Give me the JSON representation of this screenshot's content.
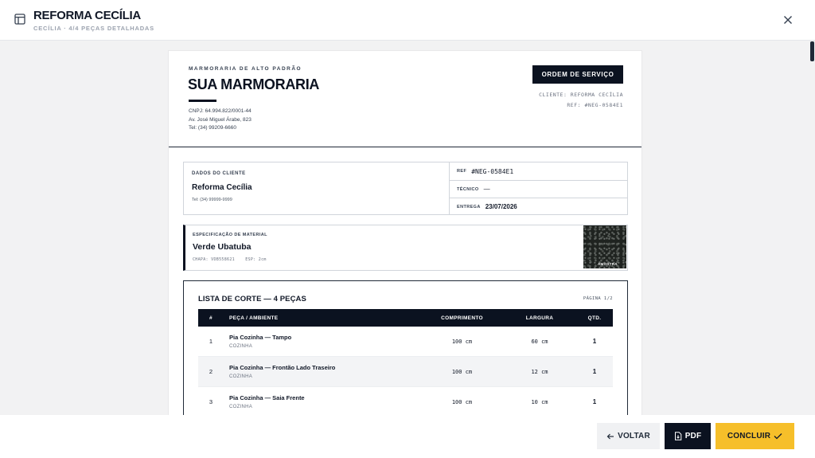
{
  "header": {
    "title": "REFORMA CECÍLIA",
    "subtitle": "CECÍLIA · 4/4 PEÇAS DETALHADAS"
  },
  "document": {
    "company_kicker": "MARMORARIA DE ALTO PADRÃO",
    "company_name": "SUA MARMORARIA",
    "cnpj": "CNPJ: 64.994.822/0001-44",
    "address": "Av. José Miguel Árabe, 823",
    "phone": "Tel: (34) 99209-6660",
    "order_badge": "ORDEM DE SERVIÇO",
    "meta_client": "CLIENTE: REFORMA CECÍLIA",
    "meta_ref": "REF: #NEG-0584E1",
    "client": {
      "section_label": "DADOS DO CLIENTE",
      "name": "Reforma Cecília",
      "phone": "Tel: (34) 99999-9999",
      "ref_label": "REF",
      "ref_value": "#NEG-0584E1",
      "tech_label": "TÉCNICO",
      "tech_value": "—",
      "delivery_label": "ENTREGA",
      "delivery_value": "23/07/2026"
    },
    "material": {
      "section_label": "ESPECIFICAÇÃO DE MATERIAL",
      "name": "Verde Ubatuba",
      "meta": "CHAPA: VDB558621    ESP: 2cm",
      "sample_label": "AMOSTRA"
    },
    "cut_list": {
      "title": "LISTA DE CORTE — 4 PEÇAS",
      "page": "PÁGINA 1/2",
      "columns": [
        "#",
        "PEÇA / AMBIENTE",
        "COMPRIMENTO",
        "LARGURA",
        "QTD."
      ],
      "rows": [
        {
          "num": "1",
          "piece": "Pia Cozinha — Tampo",
          "env": "COZINHA",
          "length": "100 cm",
          "width": "60 cm",
          "qty": "1"
        },
        {
          "num": "2",
          "piece": "Pia Cozinha — Frontão Lado Traseiro",
          "env": "COZINHA",
          "length": "100 cm",
          "width": "12 cm",
          "qty": "1"
        },
        {
          "num": "3",
          "piece": "Pia Cozinha — Saia Frente",
          "env": "COZINHA",
          "length": "100 cm",
          "width": "10 cm",
          "qty": "1"
        }
      ]
    }
  },
  "footer": {
    "back_label": "VOLTAR",
    "pdf_label": "PDF",
    "done_label": "CONCLUIR"
  },
  "colors": {
    "navy": "#0b1220",
    "accent_yellow": "#f6bf2a",
    "muted": "#9ca3af"
  }
}
